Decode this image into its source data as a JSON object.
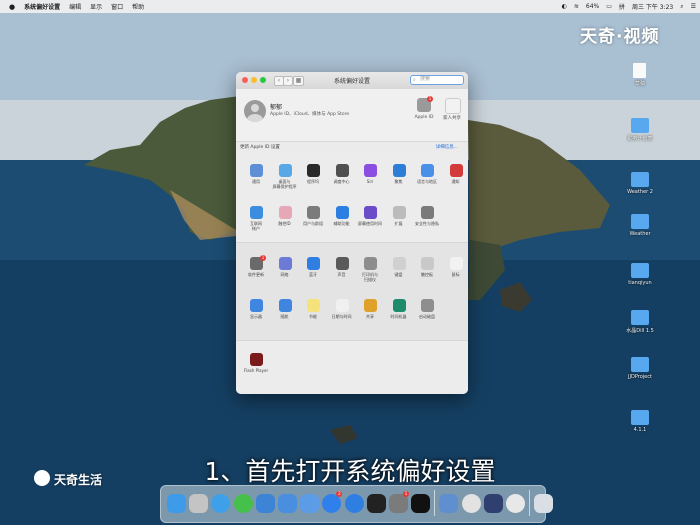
{
  "menubar": {
    "apple": "",
    "app_name": "系统偏好设置",
    "items": [
      "编辑",
      "显示",
      "窗口",
      "帮助"
    ],
    "battery": "64%",
    "datetime": "周三 下午 3:23"
  },
  "window": {
    "title": "系统偏好设置",
    "search_placeholder": "搜索",
    "user": {
      "name": "郁郁",
      "subtitle": "Apple ID、iCloud、媒体与 App Store"
    },
    "top_icons": [
      {
        "icon": "apple-id-icon",
        "label": "Apple ID",
        "badge": "1"
      },
      {
        "icon": "family-sharing-icon",
        "label": "家人共享"
      }
    ],
    "update_text": "更新 Apple ID 设置",
    "update_link": "详细信息...",
    "row1": [
      {
        "icon": "general-icon",
        "label": "通用",
        "color": "#5e8fd6"
      },
      {
        "icon": "desktop-screensaver-icon",
        "label": "桌面与\n屏幕保护程序",
        "color": "#58a7e6"
      },
      {
        "icon": "dock-icon",
        "label": "程序坞",
        "color": "#2a2a2a"
      },
      {
        "icon": "mission-control-icon",
        "label": "调度中心",
        "color": "#4f4f4f"
      },
      {
        "icon": "siri-icon",
        "label": "Siri",
        "color": "#8a4ee0"
      },
      {
        "icon": "spotlight-icon",
        "label": "聚焦",
        "color": "#2e7dd6"
      },
      {
        "icon": "language-region-icon",
        "label": "语言与地区",
        "color": "#4a8fe8"
      },
      {
        "icon": "notifications-icon",
        "label": "通知",
        "color": "#d33b3b"
      }
    ],
    "row2": [
      {
        "icon": "internet-accounts-icon",
        "label": "互联网\n帐户",
        "color": "#3c8de0"
      },
      {
        "icon": "touch-id-icon",
        "label": "触控ID",
        "color": "#e6a8b6"
      },
      {
        "icon": "users-groups-icon",
        "label": "用户与群组",
        "color": "#7b7b7b"
      },
      {
        "icon": "accessibility-icon",
        "label": "辅助功能",
        "color": "#2c7fe0"
      },
      {
        "icon": "screen-time-icon",
        "label": "屏幕使用时间",
        "color": "#6a4bc9"
      },
      {
        "icon": "extensions-icon",
        "label": "扩展",
        "color": "#bcbcbc"
      },
      {
        "icon": "security-privacy-icon",
        "label": "安全性与隐私",
        "color": "#7a7a7a"
      }
    ],
    "row3": [
      {
        "icon": "software-update-icon",
        "label": "软件更新",
        "color": "#6a6a6a",
        "badge": "1"
      },
      {
        "icon": "network-icon",
        "label": "网络",
        "color": "#6b7bd6"
      },
      {
        "icon": "bluetooth-icon",
        "label": "蓝牙",
        "color": "#2f7fe3"
      },
      {
        "icon": "sound-icon",
        "label": "声音",
        "color": "#5a5a5a"
      },
      {
        "icon": "printers-scanners-icon",
        "label": "打印机与\n扫描仪",
        "color": "#8d8d8d"
      },
      {
        "icon": "keyboard-icon",
        "label": "键盘",
        "color": "#d0d0d0"
      },
      {
        "icon": "trackpad-icon",
        "label": "触控板",
        "color": "#c9c9c9"
      },
      {
        "icon": "mouse-icon",
        "label": "鼠标",
        "color": "#f2f2f2"
      }
    ],
    "row4": [
      {
        "icon": "displays-icon",
        "label": "显示器",
        "color": "#3f86e0"
      },
      {
        "icon": "sidecar-icon",
        "label": "随航",
        "color": "#3f86e0"
      },
      {
        "icon": "energy-saver-icon",
        "label": "节能",
        "color": "#f5e27a"
      },
      {
        "icon": "date-time-icon",
        "label": "日期与时间",
        "color": "#f0f0f0"
      },
      {
        "icon": "sharing-icon",
        "label": "共享",
        "color": "#e0a12a"
      },
      {
        "icon": "time-machine-icon",
        "label": "时间机器",
        "color": "#1e8c6a"
      },
      {
        "icon": "startup-disk-icon",
        "label": "启动磁盘",
        "color": "#8e8e8e"
      }
    ],
    "row5": [
      {
        "icon": "flash-player-icon",
        "label": "Flash Player",
        "color": "#7a1a1a"
      }
    ]
  },
  "desktop_icons": [
    {
      "icon": "document-icon",
      "label": "草稿"
    },
    {
      "icon": "folder-icon",
      "label": "勤务计划表"
    },
    {
      "icon": "folder-icon",
      "label": "Weather 2"
    },
    {
      "icon": "folder-icon",
      "label": "Weather"
    },
    {
      "icon": "folder-icon",
      "label": "tianqiyun"
    },
    {
      "icon": "folder-icon",
      "label": "水晶Dill 1.5"
    },
    {
      "icon": "folder-icon",
      "label": "JJDProject"
    },
    {
      "icon": "folder-icon",
      "label": "4.1.1"
    }
  ],
  "watermark_top": "天奇·视频",
  "watermark_bottom": "天奇生活",
  "caption": "1、首先打开系统偏好设置",
  "dock_apps": [
    {
      "icon": "finder-icon",
      "color": "#3d9be9"
    },
    {
      "icon": "launchpad-icon",
      "color": "#c4c4c4"
    },
    {
      "icon": "safari-icon",
      "color": "#3ea0e8"
    },
    {
      "icon": "wechat-icon",
      "color": "#45c04a"
    },
    {
      "icon": "xcode-icon",
      "color": "#3d84d6"
    },
    {
      "icon": "archive-icon",
      "color": "#4a8ee0"
    },
    {
      "icon": "files-icon",
      "color": "#5c9be6"
    },
    {
      "icon": "app-store-icon",
      "color": "#2f80ea",
      "badge": "2"
    },
    {
      "icon": "upload-icon",
      "color": "#2f7fe3"
    },
    {
      "icon": "terminal-icon",
      "color": "#222222"
    },
    {
      "icon": "system-preferences-icon",
      "color": "#7b7b7b",
      "badge": "1"
    },
    {
      "icon": "qq-icon",
      "color": "#111111"
    },
    {
      "icon": "preview-icon",
      "color": "#5f8fcf"
    },
    {
      "icon": "photos-icon",
      "color": "#e2e2e2"
    },
    {
      "icon": "quicktime-icon",
      "color": "#2f3f6f"
    },
    {
      "icon": "chrome-icon",
      "color": "#e8e8e8"
    },
    {
      "icon": "trash-icon",
      "color": "#d9dfe5"
    }
  ]
}
